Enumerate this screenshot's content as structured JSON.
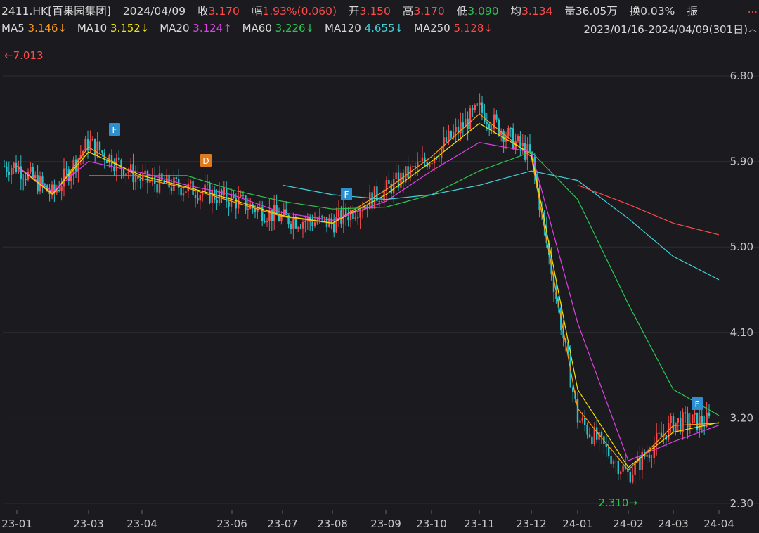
{
  "header": {
    "ticker": "2411.HK[百果园集团]",
    "date": "2024/04/09",
    "close_label": "收",
    "close_value": "3.170",
    "change_label": "幅",
    "change_value": "1.93%(0.060)",
    "open_label": "开",
    "open_value": "3.150",
    "high_label": "高",
    "high_value": "3.170",
    "low_label": "低",
    "low_value": "3.090",
    "avg_label": "均",
    "avg_value": "3.134",
    "volume": "量36.05万",
    "turnover": "换0.03%",
    "amplitude_label": "振",
    "more": "..."
  },
  "ma_legend": [
    {
      "name": "MA5",
      "value": "3.146↓",
      "color": "#ff9b1a"
    },
    {
      "name": "MA10",
      "value": "3.152↓",
      "color": "#f2e300"
    },
    {
      "name": "MA20",
      "value": "3.124↑",
      "color": "#e040e6"
    },
    {
      "name": "MA60",
      "value": "3.226↓",
      "color": "#28c850"
    },
    {
      "name": "MA120",
      "value": "4.655↓",
      "color": "#3fd0d8"
    },
    {
      "name": "MA250",
      "value": "5.128↓",
      "color": "#ff4a4a"
    }
  ],
  "range_label": "2023/01/16-2024/04/09(301日)",
  "colors": {
    "up": "#ff4a4a",
    "down": "#27c2c9",
    "bg": "#1b1b1f",
    "grid": "#2c2c32"
  },
  "chart_data": {
    "type": "line",
    "title": "",
    "ylim": [
      2.3,
      7.013
    ],
    "yticks": [
      "6.80",
      "5.90",
      "5.00",
      "4.10",
      "3.20",
      "2.30"
    ],
    "xticks": [
      "23-01",
      "23-03",
      "23-04",
      "23-06",
      "23-07",
      "23-08",
      "23-09",
      "23-10",
      "23-11",
      "23-12",
      "24-01",
      "24-02",
      "24-03",
      "24-04"
    ],
    "max_label": "7.013",
    "min_label": "2.310",
    "markers": [
      {
        "text": "F",
        "x": "23-03",
        "color": "#2b8fd0"
      },
      {
        "text": "D",
        "x": "23-05",
        "color": "#e07a1f"
      },
      {
        "text": "F",
        "x": "23-08",
        "color": "#2b8fd0"
      },
      {
        "text": "F",
        "x": "24-04",
        "color": "#2b8fd0"
      }
    ],
    "series": [
      {
        "name": "close",
        "x": [
          "23-01",
          "23-02",
          "23-03",
          "23-04",
          "23-05",
          "23-06",
          "23-07",
          "23-08",
          "23-09",
          "23-10",
          "23-11",
          "23-12",
          "24-01",
          "24-02",
          "24-03",
          "24-04"
        ],
        "values": [
          5.85,
          5.55,
          6.1,
          5.7,
          5.62,
          5.5,
          5.3,
          5.25,
          5.6,
          5.95,
          6.45,
          5.95,
          3.2,
          2.6,
          3.15,
          3.17
        ]
      },
      {
        "name": "MA5",
        "values": [
          5.85,
          5.55,
          6.05,
          5.72,
          5.62,
          5.48,
          5.32,
          5.25,
          5.6,
          5.95,
          6.4,
          5.95,
          3.3,
          2.65,
          3.12,
          3.146
        ]
      },
      {
        "name": "MA10",
        "values": [
          5.85,
          5.56,
          6.0,
          5.75,
          5.63,
          5.5,
          5.33,
          5.25,
          5.55,
          5.9,
          6.3,
          5.98,
          3.5,
          2.68,
          3.05,
          3.152
        ]
      },
      {
        "name": "MA20",
        "values": [
          5.85,
          5.58,
          5.9,
          5.78,
          5.65,
          5.55,
          5.36,
          5.28,
          5.48,
          5.8,
          6.1,
          6.0,
          4.2,
          2.75,
          2.95,
          3.124
        ]
      },
      {
        "name": "MA60",
        "values": [
          null,
          null,
          5.75,
          5.75,
          5.75,
          5.6,
          5.48,
          5.4,
          5.42,
          5.55,
          5.8,
          6.0,
          5.5,
          4.4,
          3.5,
          3.226
        ]
      },
      {
        "name": "MA120",
        "values": [
          null,
          null,
          null,
          null,
          null,
          null,
          5.65,
          5.55,
          5.5,
          5.55,
          5.65,
          5.8,
          5.7,
          5.3,
          4.9,
          4.655
        ]
      },
      {
        "name": "MA250",
        "values": [
          null,
          null,
          null,
          null,
          null,
          null,
          null,
          null,
          null,
          null,
          null,
          null,
          5.65,
          5.45,
          5.25,
          5.128
        ]
      }
    ]
  }
}
